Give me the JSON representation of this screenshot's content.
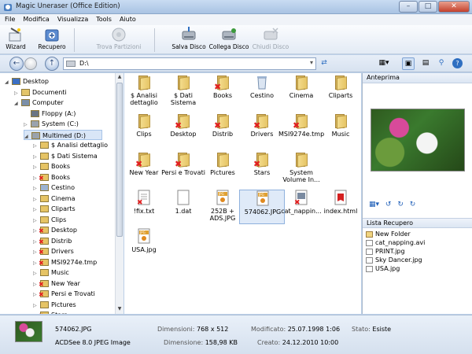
{
  "window": {
    "title": "Magic Uneraser (Office Edition)",
    "min": "–",
    "max": "□",
    "close": "✕"
  },
  "menu": [
    "File",
    "Modifica",
    "Visualizza",
    "Tools",
    "Aiuto"
  ],
  "toolbar": {
    "wizard": "Wizard",
    "recupero": "Recupero",
    "trova": "Trova Partizioni",
    "salva": "Salva Disco",
    "collega": "Collega Disco",
    "chiudi": "Chiudi Disco"
  },
  "address": {
    "path": "D:\\"
  },
  "tree": [
    {
      "label": "Desktop",
      "level": 0,
      "icon": "desktop"
    },
    {
      "label": "Documenti",
      "level": 1,
      "icon": "docs"
    },
    {
      "label": "Computer",
      "level": 1,
      "icon": "computer"
    },
    {
      "label": "Floppy (A:)",
      "level": 2,
      "icon": "floppy"
    },
    {
      "label": "System (C:)",
      "level": 2,
      "icon": "drive"
    },
    {
      "label": "Multimed (D:)",
      "level": 2,
      "icon": "drive"
    },
    {
      "label": "$ Analisi dettaglio",
      "level": 3,
      "icon": "folder"
    },
    {
      "label": "$ Dati Sistema",
      "level": 3,
      "icon": "folder"
    },
    {
      "label": "Books",
      "level": 3,
      "icon": "folder"
    },
    {
      "label": "Books",
      "level": 3,
      "icon": "folder-del"
    },
    {
      "label": "Cestino",
      "level": 3,
      "icon": "bin"
    },
    {
      "label": "Cinema",
      "level": 3,
      "icon": "folder"
    },
    {
      "label": "Cliparts",
      "level": 3,
      "icon": "folder"
    },
    {
      "label": "Clips",
      "level": 3,
      "icon": "folder"
    },
    {
      "label": "Desktop",
      "level": 3,
      "icon": "folder-del"
    },
    {
      "label": "Distrib",
      "level": 3,
      "icon": "folder-del"
    },
    {
      "label": "Drivers",
      "level": 3,
      "icon": "folder-del"
    },
    {
      "label": "MSI9274e.tmp",
      "level": 3,
      "icon": "folder-del"
    },
    {
      "label": "Music",
      "level": 3,
      "icon": "folder"
    },
    {
      "label": "New Year",
      "level": 3,
      "icon": "folder-del"
    },
    {
      "label": "Persi e Trovati",
      "level": 3,
      "icon": "folder-del"
    },
    {
      "label": "Pictures",
      "level": 3,
      "icon": "folder"
    },
    {
      "label": "Stars",
      "level": 3,
      "icon": "folder-del"
    }
  ],
  "files": [
    {
      "label": "$ Analisi dettaglio",
      "kind": "folder"
    },
    {
      "label": "$ Dati Sistema",
      "kind": "folder"
    },
    {
      "label": "Books",
      "kind": "folder-del"
    },
    {
      "label": "Cestino",
      "kind": "bin"
    },
    {
      "label": "Cinema",
      "kind": "folder"
    },
    {
      "label": "Cliparts",
      "kind": "folder"
    },
    {
      "label": "Clips",
      "kind": "folder"
    },
    {
      "label": "Desktop",
      "kind": "folder-del"
    },
    {
      "label": "Distrib",
      "kind": "folder-del"
    },
    {
      "label": "Drivers",
      "kind": "folder-del"
    },
    {
      "label": "MSI9274e.tmp",
      "kind": "folder-del"
    },
    {
      "label": "Music",
      "kind": "folder"
    },
    {
      "label": "New Year",
      "kind": "folder-del"
    },
    {
      "label": "Persi e Trovati",
      "kind": "folder-del"
    },
    {
      "label": "Pictures",
      "kind": "folder"
    },
    {
      "label": "Stars",
      "kind": "folder-del"
    },
    {
      "label": "System Volume In...",
      "kind": "folder"
    },
    {
      "label": "!fix.txt",
      "kind": "txt-del"
    },
    {
      "label": "1.dat",
      "kind": "file"
    },
    {
      "label": "252B + ADS.JPG",
      "kind": "jpg"
    },
    {
      "label": "574062.JPG",
      "kind": "jpg",
      "selected": true
    },
    {
      "label": "cat_nappin...",
      "kind": "avi-del"
    },
    {
      "label": "index.html",
      "kind": "html"
    },
    {
      "label": "USA.jpg",
      "kind": "jpg"
    }
  ],
  "right": {
    "anteprima": "Anteprima",
    "lista": "Lista Recupero",
    "recovery": [
      "New Folder",
      "cat_napping.avi",
      "PRINT.jpg",
      "Sky Dancer.jpg",
      "USA.jpg"
    ]
  },
  "status": {
    "name": "574062.JPG",
    "type": "ACDSee 8.0 JPEG Image",
    "dim_label": "Dimensioni:",
    "dim_value": "768 x 512",
    "size_label": "Dimensione:",
    "size_value": "158,98 KB",
    "mod_label": "Modificato:",
    "mod_value": "25.07.1998 1:06",
    "created_label": "Creato:",
    "created_value": "24.12.2010 10:00",
    "state_label": "Stato:",
    "state_value": "Esiste"
  }
}
